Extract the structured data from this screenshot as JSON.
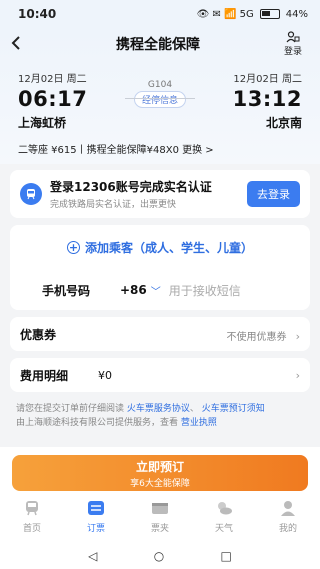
{
  "status_bar": {
    "time": "10:40",
    "indicators": "👁 ✉ 📶 5G",
    "battery": "44%"
  },
  "nav": {
    "title": "携程全能保障",
    "login_label": "登录"
  },
  "trip": {
    "depart_date": "12月02日 周二",
    "depart_time": "06:17",
    "depart_station": "上海虹桥",
    "train_no": "G104",
    "stops_label": "经停信息",
    "arrive_date": "12月02日 周二",
    "arrive_time": "13:12",
    "arrive_station": "北京南"
  },
  "ticket_info": "二等座 ¥615丨携程全能保障¥48X0 更换 >",
  "login_card": {
    "title": "登录12306账号完成实名认证",
    "subtitle": "完成铁路局实名认证，出票更快",
    "button": "去登录"
  },
  "passenger": {
    "add_label": "添加乘客（成人、学生、儿童）",
    "phone_label": "手机号码",
    "country_code": "+86",
    "phone_placeholder": "用于接收短信"
  },
  "coupon": {
    "label": "优惠券",
    "value": "不使用优惠券"
  },
  "fee": {
    "label": "费用明细",
    "amount": "¥0"
  },
  "notice": {
    "line1_prefix": "请您在提交订单前仔细阅读",
    "link1": "火车票服务协议",
    "link2": "火车票预订须知",
    "line2_prefix": "由上海顺途科技有限公司提供服务，查看",
    "link3": "营业执照"
  },
  "book_button": {
    "label": "立即预订",
    "sub": "享6大全能保障"
  },
  "tabs": [
    {
      "label": "首页"
    },
    {
      "label": "订票"
    },
    {
      "label": "票夹"
    },
    {
      "label": "天气"
    },
    {
      "label": "我的"
    }
  ],
  "colors": {
    "accent": "#3b7cf0",
    "orange": "#f07a20"
  }
}
